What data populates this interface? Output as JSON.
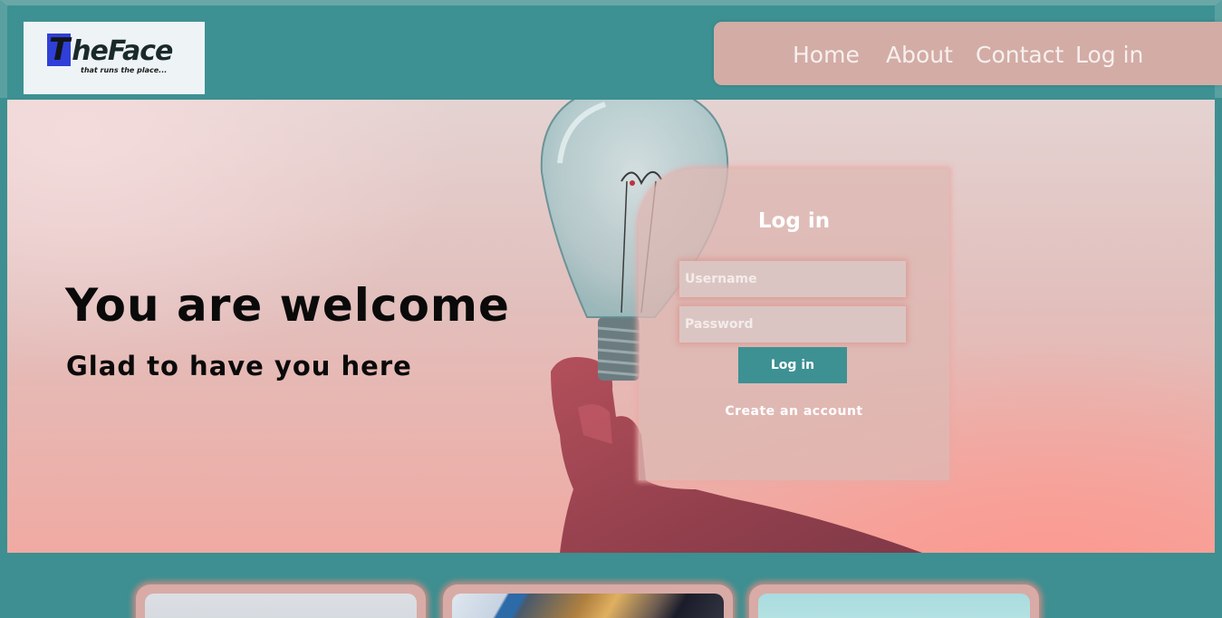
{
  "logo": {
    "initial": "T",
    "word": "heFace",
    "tagline": "that runs the place..."
  },
  "nav": {
    "items": [
      {
        "label": "Home"
      },
      {
        "label": "About"
      },
      {
        "label": "Contact"
      },
      {
        "label": "Log in"
      }
    ]
  },
  "hero": {
    "title": "You are welcome",
    "subtitle": "Glad to have you here"
  },
  "login": {
    "title": "Log in",
    "username_placeholder": "Username",
    "password_placeholder": "Password",
    "button_label": "Log in",
    "create_account_label": "Create an account"
  },
  "colors": {
    "primary_teal": "#3d9193",
    "nav_background": "#d3aca6",
    "card_background": "#d8aba6"
  },
  "cards": [
    {
      "image": "sky-photo"
    },
    {
      "image": "desk-laptop-photo"
    },
    {
      "image": "teal-sky-photo"
    }
  ]
}
